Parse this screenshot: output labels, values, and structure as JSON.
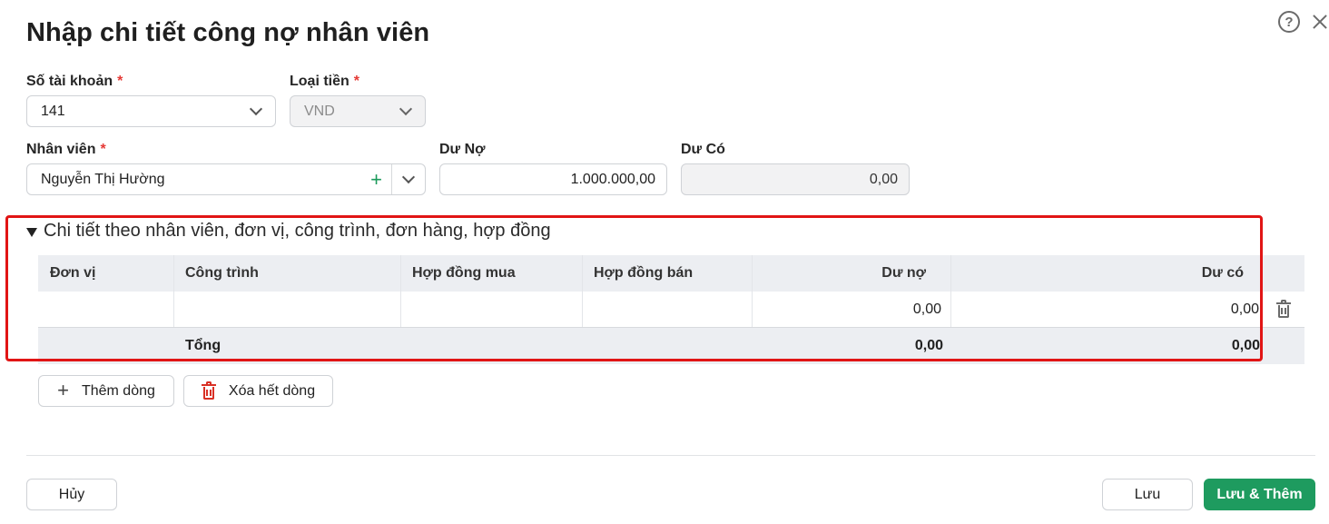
{
  "dialog": {
    "title": "Nhập chi tiết công nợ nhân viên"
  },
  "fields": {
    "account": {
      "label": "Số tài khoản",
      "required": "*",
      "value": "141"
    },
    "currency": {
      "label": "Loại tiền",
      "required": "*",
      "value": "VND"
    },
    "employee": {
      "label": "Nhân viên",
      "required": "*",
      "value": "Nguyễn Thị Hường",
      "add_symbol": "+"
    },
    "debit": {
      "label": "Dư Nợ",
      "value": "1.000.000,00"
    },
    "credit": {
      "label": "Dư Có",
      "value": "0,00"
    }
  },
  "detail_section": {
    "title": "Chi tiết theo nhân viên, đơn vị, công trình, đơn hàng, hợp đồng",
    "columns": [
      "Đơn vị",
      "Công trình",
      "Hợp đồng mua",
      "Hợp đồng bán",
      "Dư nợ",
      "Dư có"
    ],
    "rows": [
      {
        "don_vi": "",
        "cong_trinh": "",
        "hop_dong_mua": "",
        "hop_dong_ban": "",
        "du_no": "0,00",
        "du_co": "0,00"
      }
    ],
    "footer": {
      "label": "Tổng",
      "du_no": "0,00",
      "du_co": "0,00"
    }
  },
  "actions": {
    "add_row": "Thêm dòng",
    "clear_rows": "Xóa hết dòng",
    "cancel": "Hủy",
    "save": "Lưu",
    "save_and_add": "Lưu & Thêm"
  },
  "colors": {
    "primary": "#1e9b5f",
    "required": "#e53935",
    "highlight": "#e11515",
    "delete": "#d93025"
  },
  "icons": {
    "help": "help-circle-icon",
    "close": "close-icon",
    "dropdown": "chevron-down-icon",
    "add": "plus-icon",
    "delete": "trash-icon",
    "collapse": "caret-down-icon"
  }
}
